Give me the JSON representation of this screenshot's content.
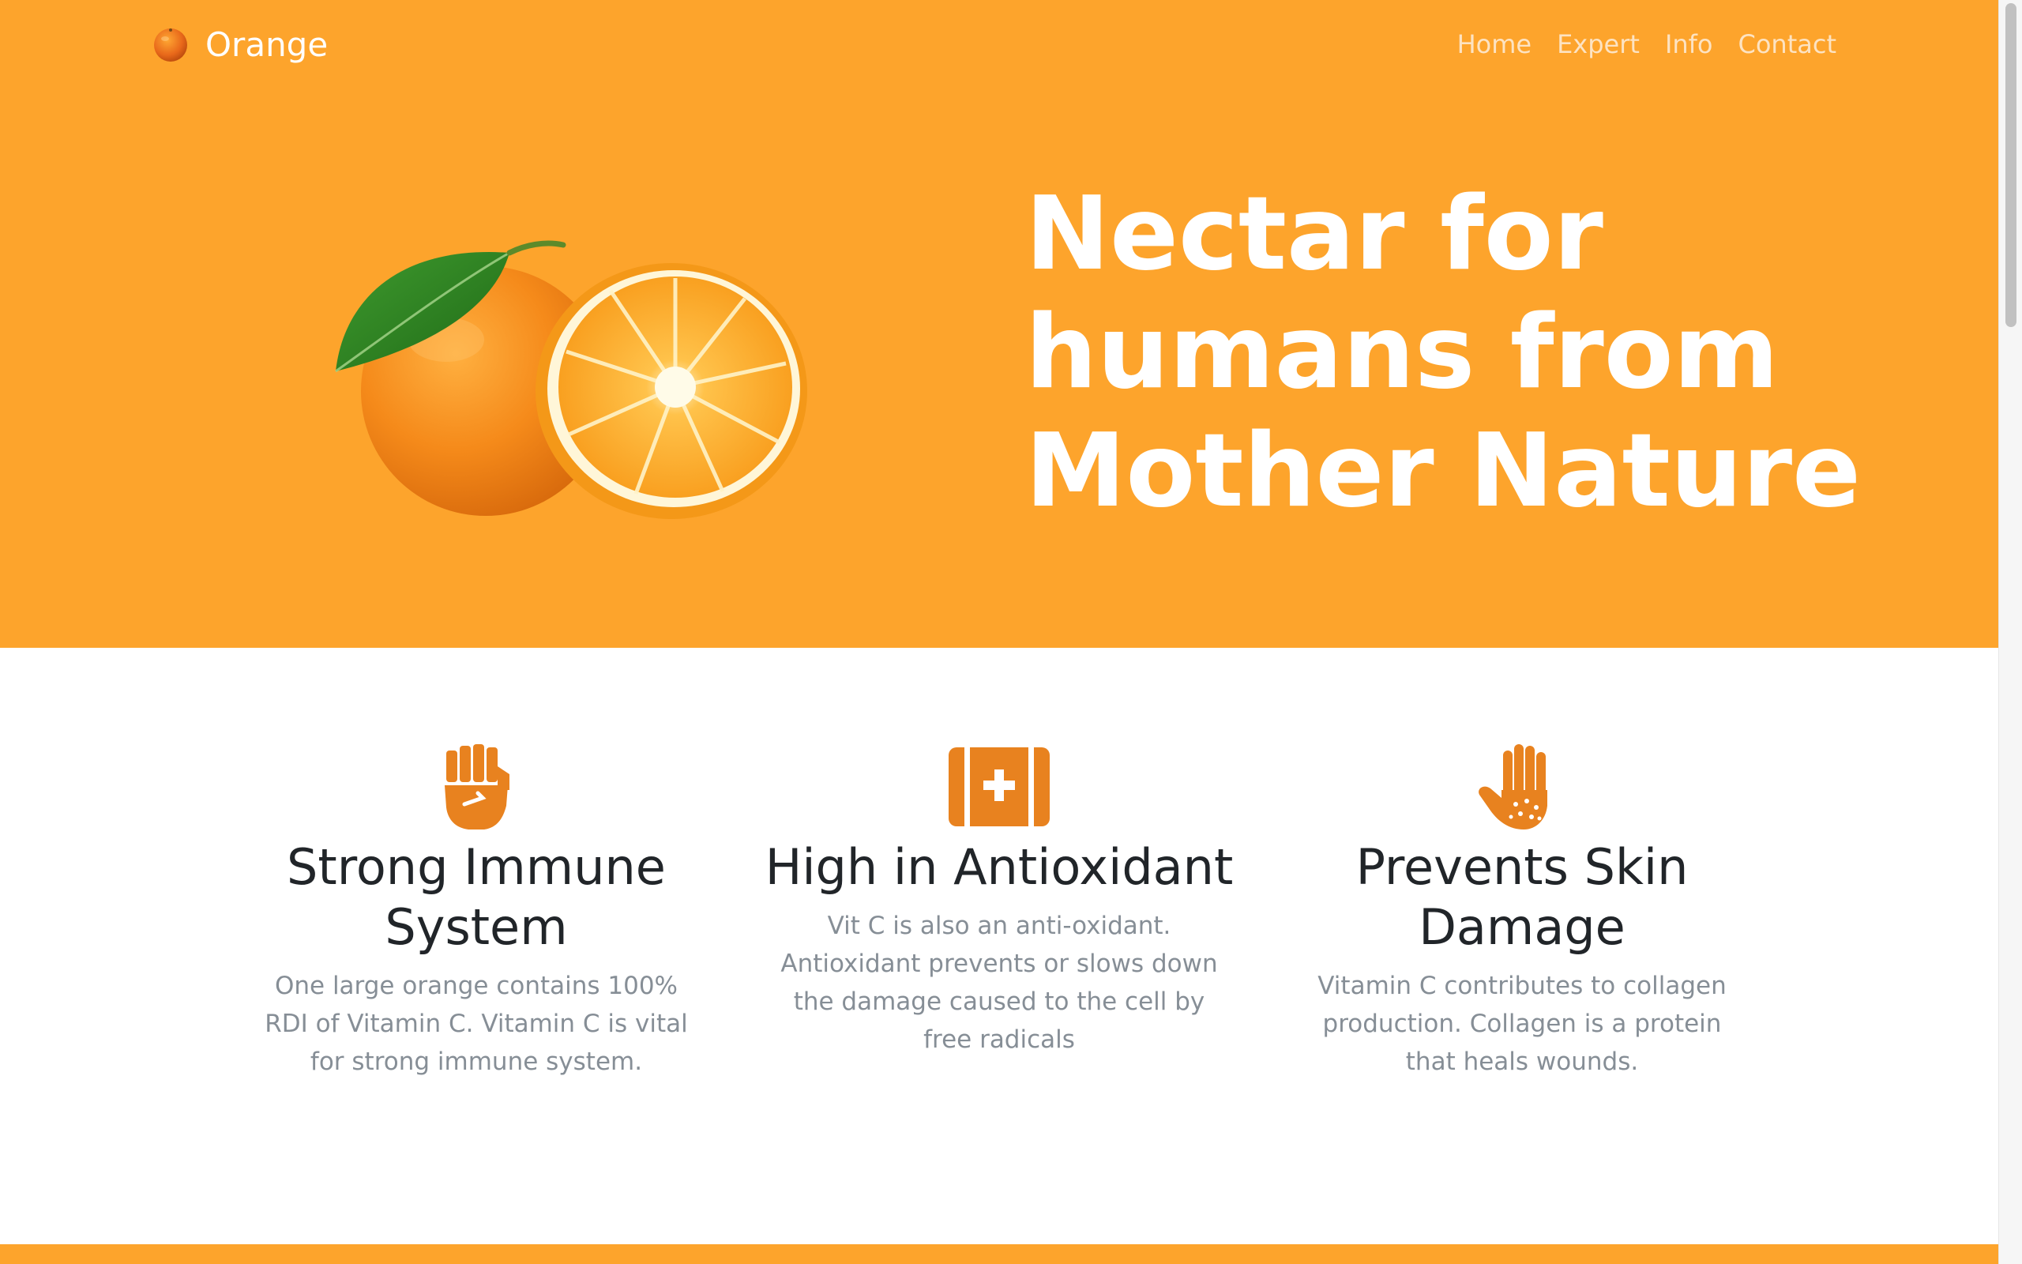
{
  "brand": {
    "name": "Orange",
    "icon": "orange-fruit-icon"
  },
  "nav": {
    "items": [
      {
        "label": "Home"
      },
      {
        "label": "Expert"
      },
      {
        "label": "Info"
      },
      {
        "label": "Contact"
      }
    ]
  },
  "hero": {
    "heading": "Nectar for humans from Mother Nature",
    "image": "orange-fruit-image"
  },
  "features": [
    {
      "icon": "raised-fist-icon",
      "title": "Strong Immune System",
      "text": "One large orange contains 100% RDI of Vitamin C. Vitamin C is vital for strong immune system."
    },
    {
      "icon": "first-aid-kit-icon",
      "title": "High in Antioxidant",
      "text": "Vit C is also an anti-oxidant. Antioxidant prevents or slows down the damage caused to the cell by free radicals"
    },
    {
      "icon": "allergy-hand-icon",
      "title": "Prevents Skin Damage",
      "text": "Vitamin C contributes to collagen production. Collagen is a protein that heals wounds."
    }
  ],
  "colors": {
    "brand_orange": "#fda42c",
    "icon_orange": "#e8821f",
    "heading_dark": "#212529",
    "muted_text": "#868e96"
  }
}
